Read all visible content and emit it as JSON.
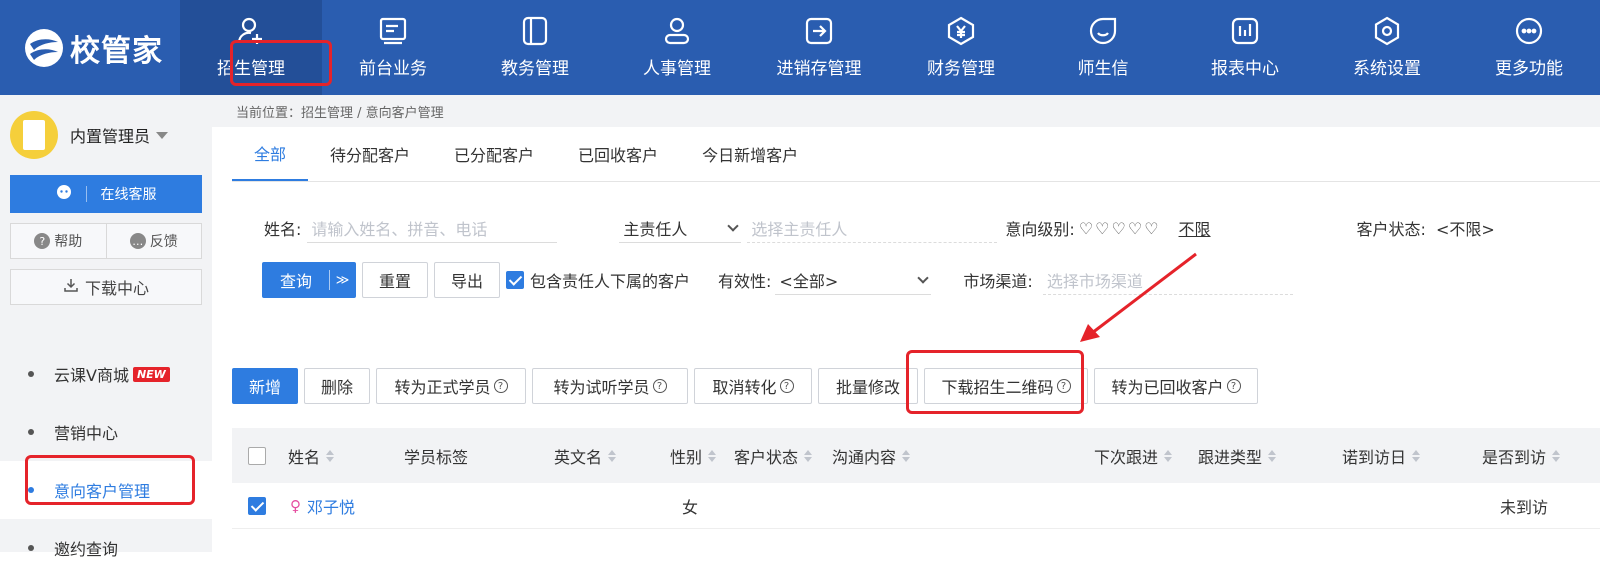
{
  "brand": {
    "name": "校管家"
  },
  "nav": {
    "items": [
      {
        "label": "招生管理",
        "icon": "user-add-icon"
      },
      {
        "label": "前台业务",
        "icon": "form-icon"
      },
      {
        "label": "教务管理",
        "icon": "book-icon"
      },
      {
        "label": "人事管理",
        "icon": "person-icon"
      },
      {
        "label": "进销存管理",
        "icon": "inout-icon"
      },
      {
        "label": "财务管理",
        "icon": "yen-icon"
      },
      {
        "label": "师生信",
        "icon": "chat-icon"
      },
      {
        "label": "报表中心",
        "icon": "report-icon"
      },
      {
        "label": "系统设置",
        "icon": "settings-icon"
      },
      {
        "label": "更多功能",
        "icon": "more-icon"
      }
    ],
    "active": "招生管理"
  },
  "sidebar": {
    "user_name": "内置管理员",
    "online_service": "在线客服",
    "help": "帮助",
    "feedback": "反馈",
    "download_center": "下载中心",
    "menu": [
      {
        "label": "云课V商城",
        "badge": "NEW"
      },
      {
        "label": "营销中心"
      },
      {
        "label": "意向客户管理",
        "active": true
      },
      {
        "label": "邀约查询"
      }
    ]
  },
  "breadcrumb": "当前位置：招生管理 / 意向客户管理",
  "tabs": [
    "全部",
    "待分配客户",
    "已分配客户",
    "已回收客户",
    "今日新增客户"
  ],
  "filters": {
    "name_label": "姓名:",
    "name_placeholder": "请输入姓名、拼音、电话",
    "owner_select": "主责任人",
    "owner_placeholder": "选择主责任人",
    "intent_label": "意向级别:",
    "intent_unlimited": "不限",
    "status_label": "客户状态:",
    "status_value": "<不限>",
    "validity_label": "有效性:",
    "validity_value": "<全部>",
    "channel_label": "市场渠道:",
    "channel_placeholder": "选择市场渠道"
  },
  "buttons": {
    "query": "查询",
    "reset": "重置",
    "export": "导出",
    "include_subordinates": "包含责任人下属的客户"
  },
  "actions": [
    "新增",
    "删除",
    "转为正式学员",
    "转为试听学员",
    "取消转化",
    "批量修改",
    "下载招生二维码",
    "转为已回收客户"
  ],
  "table": {
    "columns": [
      "姓名",
      "学员标签",
      "英文名",
      "性别",
      "客户状态",
      "沟通内容",
      "下次跟进",
      "跟进类型",
      "诺到访日",
      "是否到访"
    ],
    "rows": [
      {
        "name": "邓子悦",
        "gender": "女",
        "visited": "未到访",
        "checked": true
      }
    ]
  },
  "colors": {
    "primary": "#2e7ce0",
    "nav_bg": "#2a5db0",
    "highlight": "#e5232a"
  }
}
